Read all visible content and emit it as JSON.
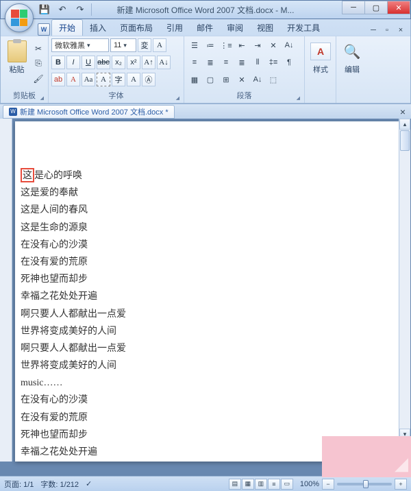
{
  "window": {
    "title": "新建 Microsoft Office Word 2007 文档.docx - M..."
  },
  "qat": {
    "save": "💾",
    "undo": "↶",
    "redo": "↷"
  },
  "tabs": [
    "开始",
    "插入",
    "页面布局",
    "引用",
    "邮件",
    "审阅",
    "视图",
    "开发工具"
  ],
  "groups": {
    "clipboard": "剪贴板",
    "paste": "粘贴",
    "font": "字体",
    "para": "段落",
    "styles": "样式",
    "edit": "编辑"
  },
  "font": {
    "name": "微软雅黑",
    "size": "11"
  },
  "doc_tab": "新建 Microsoft Office Word 2007 文档.docx *",
  "lines": [
    "这是心的呼唤",
    "这是爱的奉献",
    "这是人间的春风",
    "这是生命的源泉",
    "在没有心的沙漠",
    "在没有爱的荒原",
    "死神也望而却步",
    "幸福之花处处开遍",
    "啊只要人人都献出一点爱",
    "世界将变成美好的人间",
    "啊只要人人都献出一点爱",
    "世界将变成美好的人间",
    "music……",
    "在没有心的沙漠",
    "在没有爱的荒原",
    "死神也望而却步",
    "幸福之花处处开遍"
  ],
  "highlight_char": "这",
  "status": {
    "page": "页面: 1/1",
    "words": "字数: 1/212",
    "zoom": "100%"
  }
}
